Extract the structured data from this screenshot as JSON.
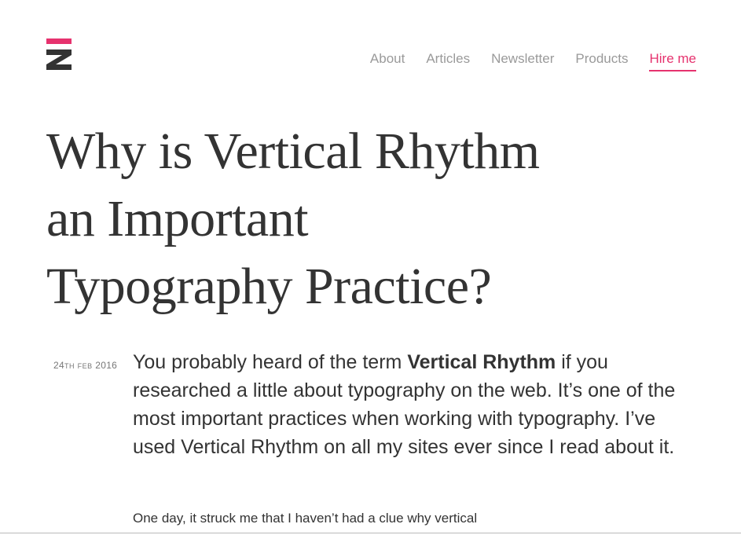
{
  "logo": {
    "letter": "z",
    "icon": "z-logo-icon",
    "accent_color": "#e6326e",
    "dark_color": "#333333"
  },
  "nav": {
    "items": [
      {
        "label": "About",
        "active": false
      },
      {
        "label": "Articles",
        "active": false
      },
      {
        "label": "Newsletter",
        "active": false
      },
      {
        "label": "Products",
        "active": false
      },
      {
        "label": "Hire me",
        "active": true
      }
    ],
    "active_color": "#e6326e",
    "inactive_color": "#9a9a9a"
  },
  "article": {
    "title_line1": "Why is Vertical Rhythm",
    "title_line2": "an Important",
    "title_line3": "Typography Practice?",
    "date_day": "24",
    "date_suffix": "th",
    "date_month": "feb",
    "date_year": "2016",
    "lead_before": "You probably heard of the term ",
    "lead_bold": "Vertical Rhythm",
    "lead_after": " if you researched a little about typography on the web. It’s one of the most important practices when working with typography. I’ve used Vertical Rhythm on all my sites ever since I read about it.",
    "para_line1": "One day, it struck me that I haven’t had a clue why vertical"
  }
}
